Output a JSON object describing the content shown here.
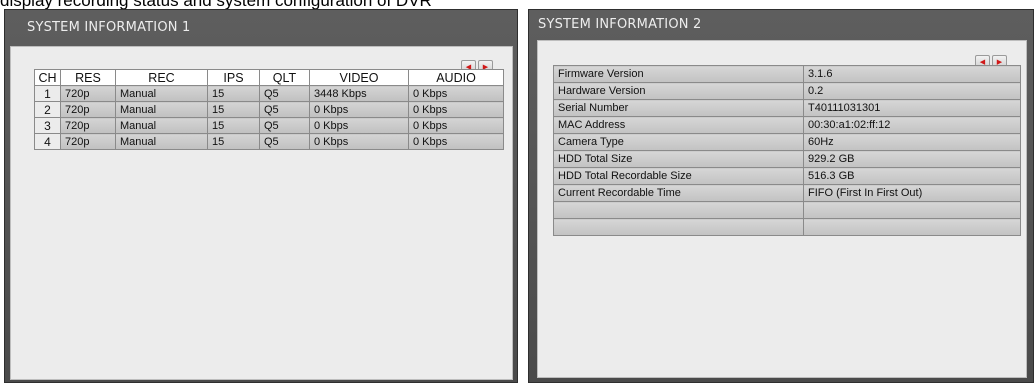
{
  "caption": "display recording status and system configuration of DVR",
  "panel1": {
    "title": "SYSTEM INFORMATION 1",
    "nav_prev_icon": "left-arrow-icon",
    "nav_next_icon": "right-arrow-icon",
    "headers": [
      "CH",
      "RES",
      "REC",
      "IPS",
      "QLT",
      "VIDEO",
      "AUDIO"
    ],
    "rows": [
      [
        "1",
        "720p",
        "Manual",
        "15",
        "Q5",
        "3448 Kbps",
        "0 Kbps"
      ],
      [
        "2",
        "720p",
        "Manual",
        "15",
        "Q5",
        "0 Kbps",
        "0 Kbps"
      ],
      [
        "3",
        "720p",
        "Manual",
        "15",
        "Q5",
        "0 Kbps",
        "0 Kbps"
      ],
      [
        "4",
        "720p",
        "Manual",
        "15",
        "Q5",
        "0 Kbps",
        "0 Kbps"
      ]
    ]
  },
  "panel2": {
    "title": "SYSTEM INFORMATION 2",
    "rows": [
      [
        "Firmware Version",
        "3.1.6"
      ],
      [
        "Hardware Version",
        "0.2"
      ],
      [
        "Serial Number",
        "T40111031301"
      ],
      [
        "MAC Address",
        "00:30:a1:02:ff:12"
      ],
      [
        "Camera Type",
        "60Hz"
      ],
      [
        "HDD Total Size",
        "929.2 GB"
      ],
      [
        "HDD Total Recordable Size",
        "516.3 GB"
      ],
      [
        "Current Recordable Time",
        "FIFO (First In First Out)"
      ],
      [
        "",
        ""
      ],
      [
        "",
        ""
      ]
    ]
  },
  "colors": {
    "panel_bg": "#4a4a4a",
    "body_bg": "#ececec",
    "cell_bg": "#c8c8c8",
    "arrow": "#d01818"
  }
}
